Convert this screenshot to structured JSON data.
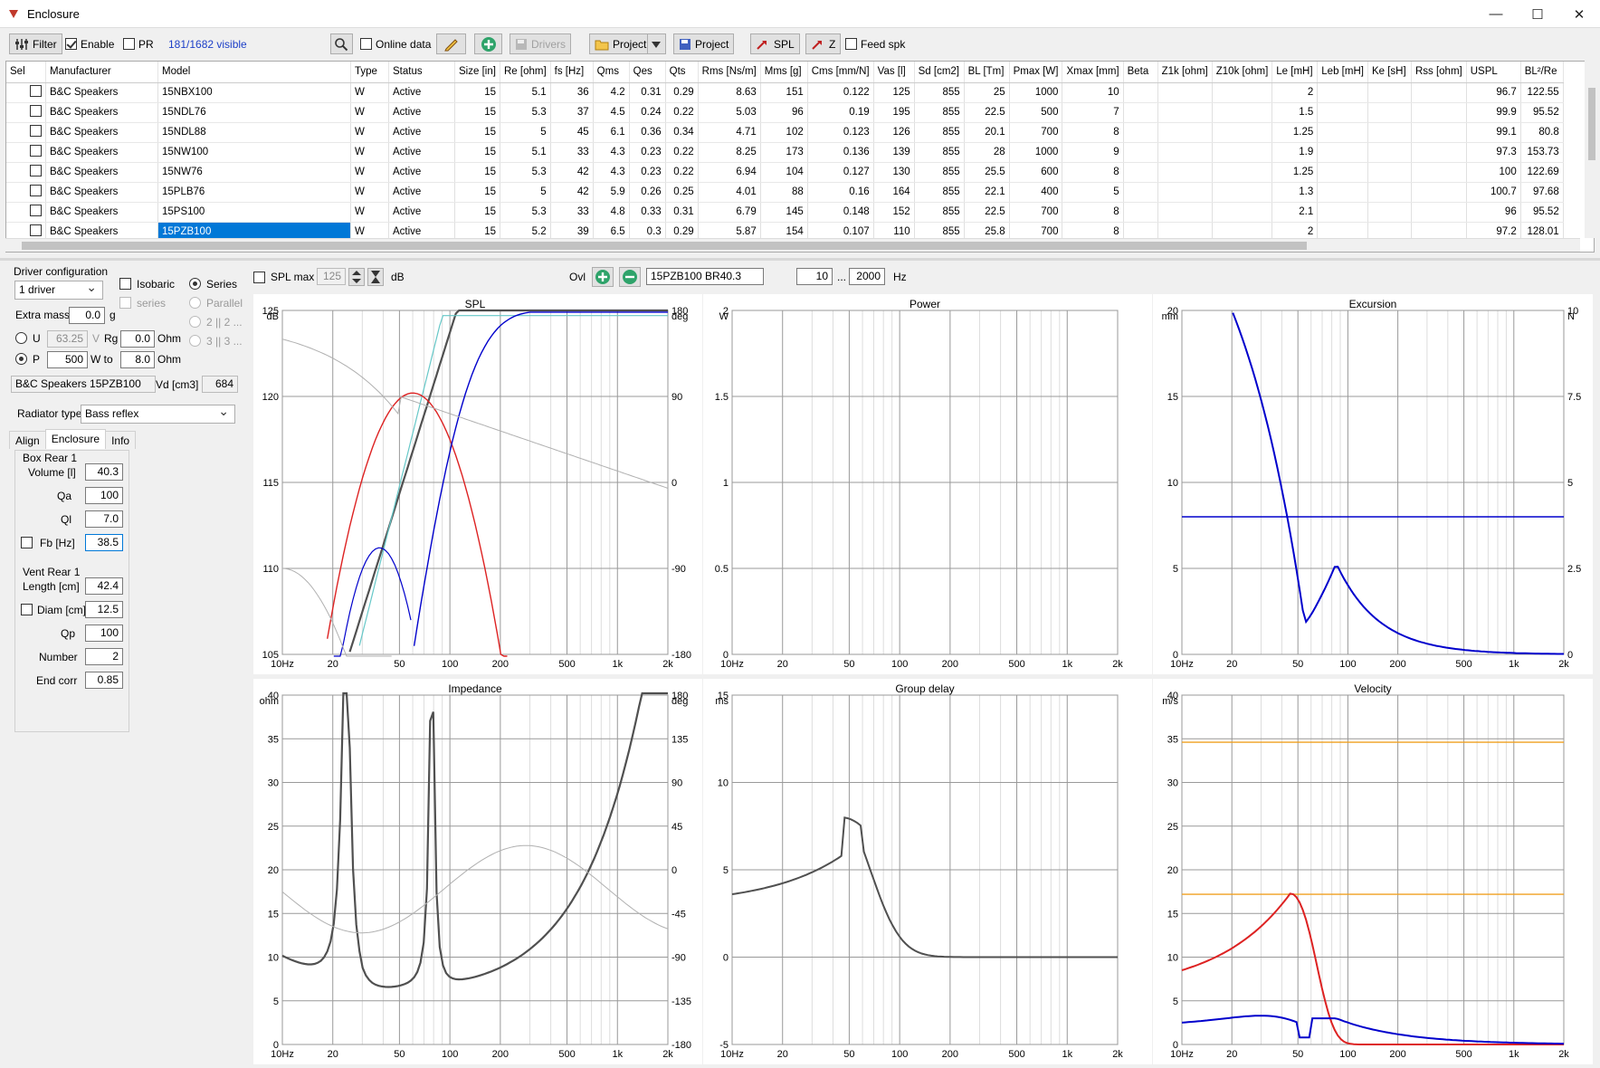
{
  "window": {
    "title": "Enclosure",
    "min": "—",
    "max": "☐",
    "close": "✕"
  },
  "toolbar": {
    "filter": "Filter",
    "enable": "Enable",
    "pr": "PR",
    "visible": "181/1682 visible",
    "online_data": "Online data",
    "drivers": "Drivers",
    "project1": "Project",
    "project2": "Project",
    "spl": "SPL",
    "z": "Z",
    "feed_spk": "Feed spk"
  },
  "grid": {
    "columns": [
      "Sel",
      "Manufacturer",
      "Model",
      "Type",
      "Status",
      "Size [in]",
      "Re [ohm]",
      "fs [Hz]",
      "Qms",
      "Qes",
      "Qts",
      "Rms [Ns/m]",
      "Mms [g]",
      "Cms [mm/N]",
      "Vas [l]",
      "Sd [cm2]",
      "BL [Tm]",
      "Pmax [W]",
      "Xmax [mm]",
      "Beta",
      "Z1k [ohm]",
      "Z10k [ohm]",
      "Le [mH]",
      "Leb [mH]",
      "Ke [sH]",
      "Rss [ohm]",
      "USPL",
      "BL²/Re"
    ],
    "rows": [
      [
        "",
        "B&C Speakers",
        "15NBX100",
        "W",
        "Active",
        "15",
        "5.1",
        "36",
        "4.2",
        "0.31",
        "0.29",
        "8.63",
        "151",
        "0.122",
        "125",
        "855",
        "25",
        "1000",
        "10",
        "",
        "",
        "",
        "2",
        "",
        "",
        "",
        "96.7",
        "122.55"
      ],
      [
        "",
        "B&C Speakers",
        "15NDL76",
        "W",
        "Active",
        "15",
        "5.3",
        "37",
        "4.5",
        "0.24",
        "0.22",
        "5.03",
        "96",
        "0.19",
        "195",
        "855",
        "22.5",
        "500",
        "7",
        "",
        "",
        "",
        "1.5",
        "",
        "",
        "",
        "99.9",
        "95.52"
      ],
      [
        "",
        "B&C Speakers",
        "15NDL88",
        "W",
        "Active",
        "15",
        "5",
        "45",
        "6.1",
        "0.36",
        "0.34",
        "4.71",
        "102",
        "0.123",
        "126",
        "855",
        "20.1",
        "700",
        "8",
        "",
        "",
        "",
        "1.25",
        "",
        "",
        "",
        "99.1",
        "80.8"
      ],
      [
        "",
        "B&C Speakers",
        "15NW100",
        "W",
        "Active",
        "15",
        "5.1",
        "33",
        "4.3",
        "0.23",
        "0.22",
        "8.25",
        "173",
        "0.136",
        "139",
        "855",
        "28",
        "1000",
        "9",
        "",
        "",
        "",
        "1.9",
        "",
        "",
        "",
        "97.3",
        "153.73"
      ],
      [
        "",
        "B&C Speakers",
        "15NW76",
        "W",
        "Active",
        "15",
        "5.3",
        "42",
        "4.3",
        "0.23",
        "0.22",
        "6.94",
        "104",
        "0.127",
        "130",
        "855",
        "25.5",
        "600",
        "8",
        "",
        "",
        "",
        "1.25",
        "",
        "",
        "",
        "100",
        "122.69"
      ],
      [
        "",
        "B&C Speakers",
        "15PLB76",
        "W",
        "Active",
        "15",
        "5",
        "42",
        "5.9",
        "0.26",
        "0.25",
        "4.01",
        "88",
        "0.16",
        "164",
        "855",
        "22.1",
        "400",
        "5",
        "",
        "",
        "",
        "1.3",
        "",
        "",
        "",
        "100.7",
        "97.68"
      ],
      [
        "",
        "B&C Speakers",
        "15PS100",
        "W",
        "Active",
        "15",
        "5.3",
        "33",
        "4.8",
        "0.33",
        "0.31",
        "6.79",
        "145",
        "0.148",
        "152",
        "855",
        "22.5",
        "700",
        "8",
        "",
        "",
        "",
        "2.1",
        "",
        "",
        "",
        "96",
        "95.52"
      ],
      [
        "",
        "B&C Speakers",
        "15PZB100",
        "W",
        "Active",
        "15",
        "5.2",
        "39",
        "6.5",
        "0.3",
        "0.29",
        "5.87",
        "154",
        "0.107",
        "110",
        "855",
        "25.8",
        "700",
        "8",
        "",
        "",
        "",
        "2",
        "",
        "",
        "",
        "97.2",
        "128.01"
      ]
    ]
  },
  "left": {
    "driver_config": "Driver configuration",
    "drivers_combo": "1 driver",
    "isobaric": "Isobaric",
    "series_cb": "series",
    "series": "Series",
    "parallel": "Parallel",
    "opt1": "2 || 2 ...",
    "opt2": "3 || 3 ...",
    "extra_mass": "Extra mass",
    "extra_mass_val": "0.0",
    "g": "g",
    "u": "U",
    "u_val": "63.25",
    "v": "V",
    "rg": "Rg",
    "rg_val": "0.0",
    "ohm1": "Ohm",
    "p": "P",
    "p_val": "500",
    "wto": "W to",
    "wto_val": "8.0",
    "ohm2": "Ohm",
    "driver_name": "B&C Speakers 15PZB100",
    "vd": "Vd [cm3]",
    "vd_val": "684",
    "radiator_type": "Radiator type",
    "radiator_val": "Bass reflex",
    "tabs": [
      "Align",
      "Enclosure",
      "Info"
    ],
    "box": "Box Rear 1",
    "volume": "Volume [l]",
    "volume_val": "40.3",
    "qa": "Qa",
    "qa_val": "100",
    "ql": "Ql",
    "ql_val": "7.0",
    "fb": "Fb [Hz]",
    "fb_val": "38.5",
    "vent": "Vent Rear 1",
    "length": "Length [cm]",
    "length_val": "42.4",
    "diam": "Diam [cm]",
    "diam_val": "12.5",
    "qp": "Qp",
    "qp_val": "100",
    "number": "Number",
    "number_val": "2",
    "endcorr": "End corr",
    "endcorr_val": "0.85"
  },
  "plotbar": {
    "splmax": "SPL max",
    "splmax_val": "125",
    "db": "dB",
    "ovl": "Ovl",
    "ovl_name": "15PZB100 BR40.3",
    "f_from": "10",
    "dots": "...",
    "f_to": "2000",
    "hz": "Hz"
  },
  "plots": {
    "spl": {
      "title": "SPL",
      "yunit": "dB",
      "y2unit": "deg",
      "yticks": [
        "125",
        "120",
        "115",
        "110",
        "105"
      ],
      "y2ticks": [
        "180",
        "90",
        "0",
        "-90",
        "-180"
      ]
    },
    "power": {
      "title": "Power",
      "yunit": "W",
      "yticks": [
        "2",
        "1.5",
        "1",
        "0.5",
        "0"
      ]
    },
    "excursion": {
      "title": "Excursion",
      "yunit": "mm",
      "y2unit": "N",
      "yticks": [
        "20",
        "15",
        "10",
        "5",
        "0"
      ],
      "y2ticks": [
        "10",
        "7.5",
        "5",
        "2.5",
        "0"
      ]
    },
    "impedance": {
      "title": "Impedance",
      "yunit": "ohm",
      "y2unit": "deg",
      "yticks": [
        "40",
        "35",
        "30",
        "25",
        "20",
        "15",
        "10",
        "5",
        "0"
      ],
      "y2ticks": [
        "180",
        "135",
        "90",
        "45",
        "0",
        "-45",
        "-90",
        "-135",
        "-180"
      ]
    },
    "groupdelay": {
      "title": "Group delay",
      "yunit": "ms",
      "yticks": [
        "15",
        "10",
        "5",
        "0",
        "-5"
      ]
    },
    "velocity": {
      "title": "Velocity",
      "yunit": "m/s",
      "yticks": [
        "40",
        "35",
        "30",
        "25",
        "20",
        "15",
        "10",
        "5",
        "0"
      ]
    },
    "xticks": [
      "10Hz",
      "20",
      "50",
      "100",
      "200",
      "500",
      "1k",
      "2k"
    ]
  },
  "colors": {
    "accent": "#0078d7",
    "blue": "#0000cc",
    "red": "#dd2222",
    "gray": "#505050",
    "light": "#b0b0b0",
    "teal": "#66c8c8",
    "orange": "#f0a020"
  }
}
